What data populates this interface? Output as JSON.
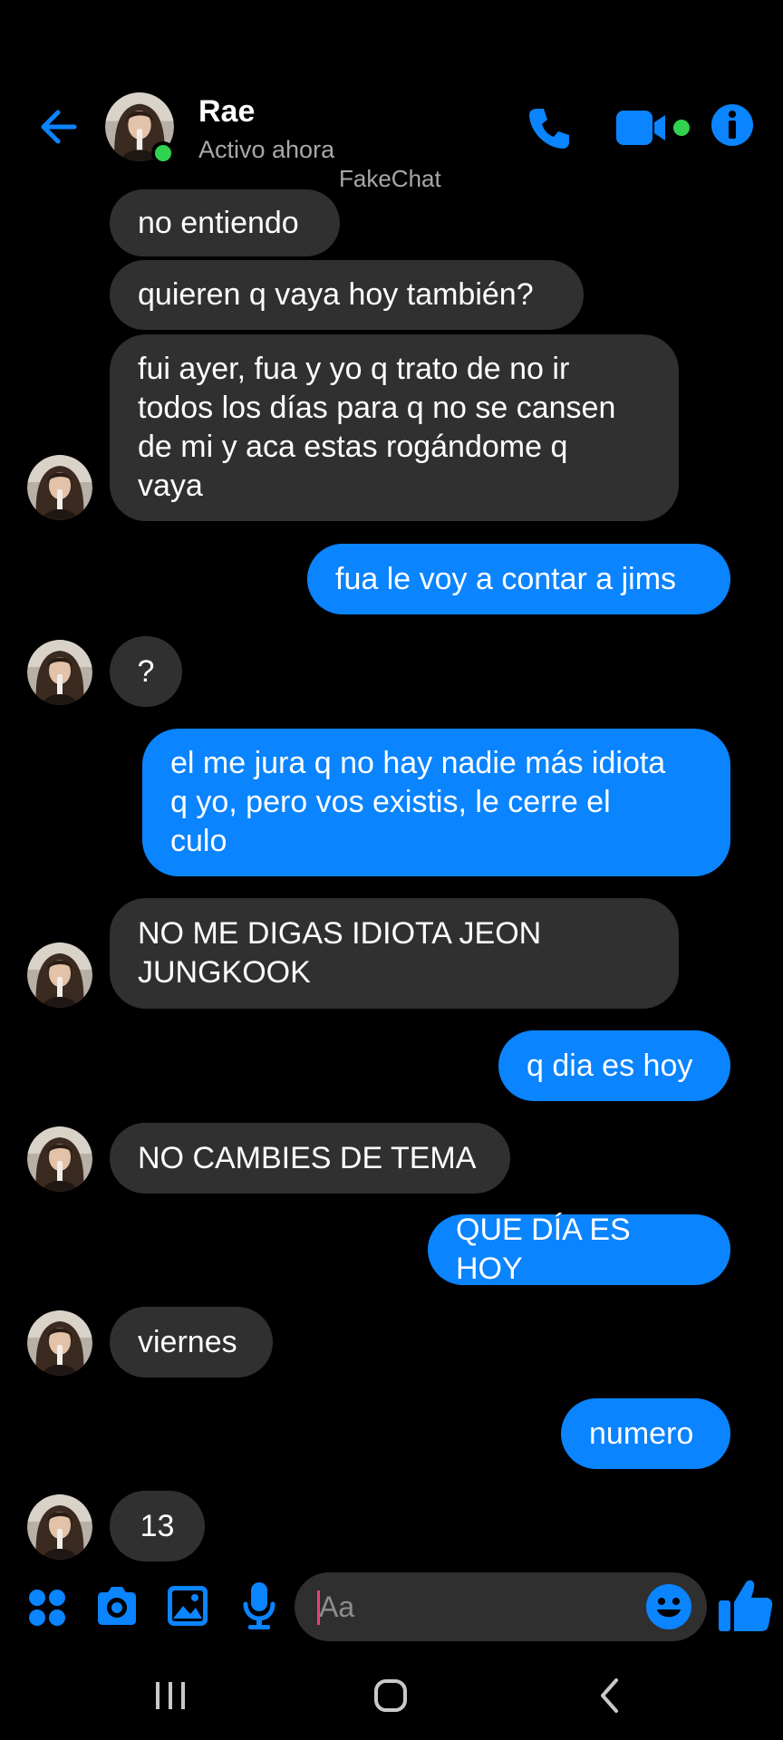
{
  "header": {
    "contact_name": "Rae",
    "status": "Activo ahora",
    "watermark": "FakeChat"
  },
  "messages": [
    {
      "side": "in",
      "text": "no entiendo"
    },
    {
      "side": "in",
      "text": "quieren q vaya hoy también?"
    },
    {
      "side": "in",
      "lines": [
        "fui ayer, fua y yo q trato de no ir",
        "todos los días para q no se cansen",
        "de mi y aca estas rogándome q",
        "vaya"
      ]
    },
    {
      "side": "out",
      "text": "fua le voy a contar a jims"
    },
    {
      "side": "in",
      "text": "?"
    },
    {
      "side": "out",
      "lines": [
        "el me jura q no hay nadie más idiota",
        "q yo, pero vos existis, le cerre el",
        "culo"
      ]
    },
    {
      "side": "in",
      "lines": [
        "NO ME DIGAS IDIOTA JEON",
        "JUNGKOOK"
      ]
    },
    {
      "side": "out",
      "text": "q dia es hoy"
    },
    {
      "side": "in",
      "text": "NO CAMBIES DE TEMA"
    },
    {
      "side": "out",
      "text": "QUE DÍA ES HOY"
    },
    {
      "side": "in",
      "text": "viernes"
    },
    {
      "side": "out",
      "text": "numero"
    },
    {
      "side": "in",
      "text": "13"
    }
  ],
  "composer": {
    "placeholder": "Aa"
  },
  "colors": {
    "accent": "#0a84ff",
    "incoming_bubble": "#303030",
    "online": "#31d24f",
    "caret": "#e8417a"
  },
  "icons": [
    "back-arrow-icon",
    "phone-icon",
    "video-camera-icon",
    "info-icon",
    "apps-grid-icon",
    "camera-icon",
    "image-icon",
    "microphone-icon",
    "emoji-icon",
    "thumbs-up-icon",
    "recent-apps-icon",
    "home-icon",
    "nav-back-icon"
  ]
}
